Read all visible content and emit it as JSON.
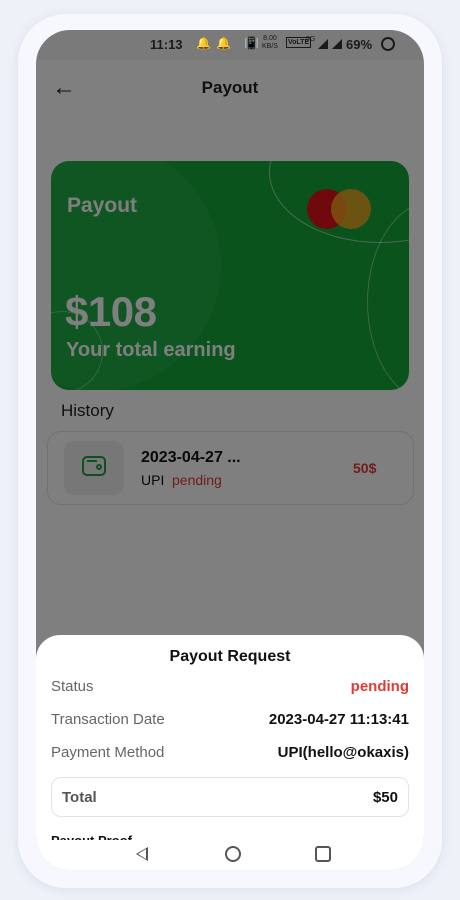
{
  "status_bar": {
    "time": "11:13",
    "speed_top": "8.00",
    "speed_bottom": "KB/S",
    "volte": "VoLTE",
    "network": "5G",
    "battery": "69%"
  },
  "header": {
    "title": "Payout",
    "back_icon": "arrow-left-icon"
  },
  "card": {
    "label": "Payout",
    "amount": "$108",
    "subtitle": "Your total earning",
    "logo_icon": "mastercard-icon",
    "background_color": "#14a73a"
  },
  "history": {
    "title": "History",
    "items": [
      {
        "date": "2023-04-27 ...",
        "method": "UPI",
        "status": "pending",
        "amount": "50$",
        "icon": "wallet-icon"
      }
    ]
  },
  "sheet": {
    "title": "Payout Request",
    "rows": [
      {
        "label": "Status",
        "value": "pending"
      },
      {
        "label": "Transaction Date",
        "value": "2023-04-27 11:13:41"
      },
      {
        "label": "Payment Method",
        "value": "UPI(hello@okaxis)"
      }
    ],
    "total_label": "Total",
    "total_value": "$50",
    "proof_label": "Payout Proof"
  },
  "colors": {
    "accent_green": "#14a73a",
    "status_red": "#e53935"
  }
}
